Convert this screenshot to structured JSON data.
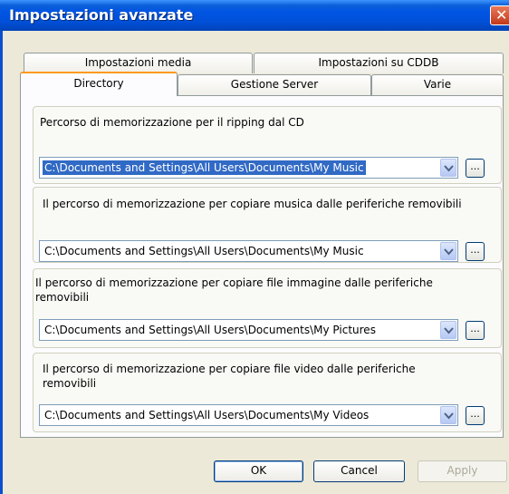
{
  "window": {
    "title": "Impostazioni avanzate"
  },
  "tabs": {
    "media": "Impostazioni media",
    "cddb": "Impostazioni su CDDB",
    "directory": "Directory",
    "server": "Gestione Server",
    "varie": "Varie"
  },
  "groups": [
    {
      "label": "Percorso di memorizzazione per il ripping dal CD",
      "path": "C:\\Documents and Settings\\All Users\\Documents\\My Music",
      "browse": "..."
    },
    {
      "label": "Il percorso di memorizzazione per copiare musica dalle periferiche removibili",
      "path": "C:\\Documents and Settings\\All Users\\Documents\\My Music",
      "browse": "..."
    },
    {
      "label_line1": "Il percorso di memorizzazione per copiare file immagine dalle periferiche",
      "label_line2": "removibili",
      "path": "C:\\Documents and Settings\\All Users\\Documents\\My Pictures",
      "browse": "..."
    },
    {
      "label_line1": "Il percorso di memorizzazione per copiare file video dalle periferiche",
      "label_line2": "removibili",
      "path": "C:\\Documents and Settings\\All Users\\Documents\\My Videos",
      "browse": "..."
    }
  ],
  "buttons": {
    "ok": "OK",
    "cancel": "Cancel",
    "apply": "Apply"
  },
  "icons": {
    "close": "close-icon",
    "dropdown": "chevron-down-icon"
  },
  "colors": {
    "title_bar": "#0054e3",
    "selection": "#316ac5",
    "active_tab_accent": "#ff9a1f",
    "dialog_bg": "#ece9d8"
  }
}
